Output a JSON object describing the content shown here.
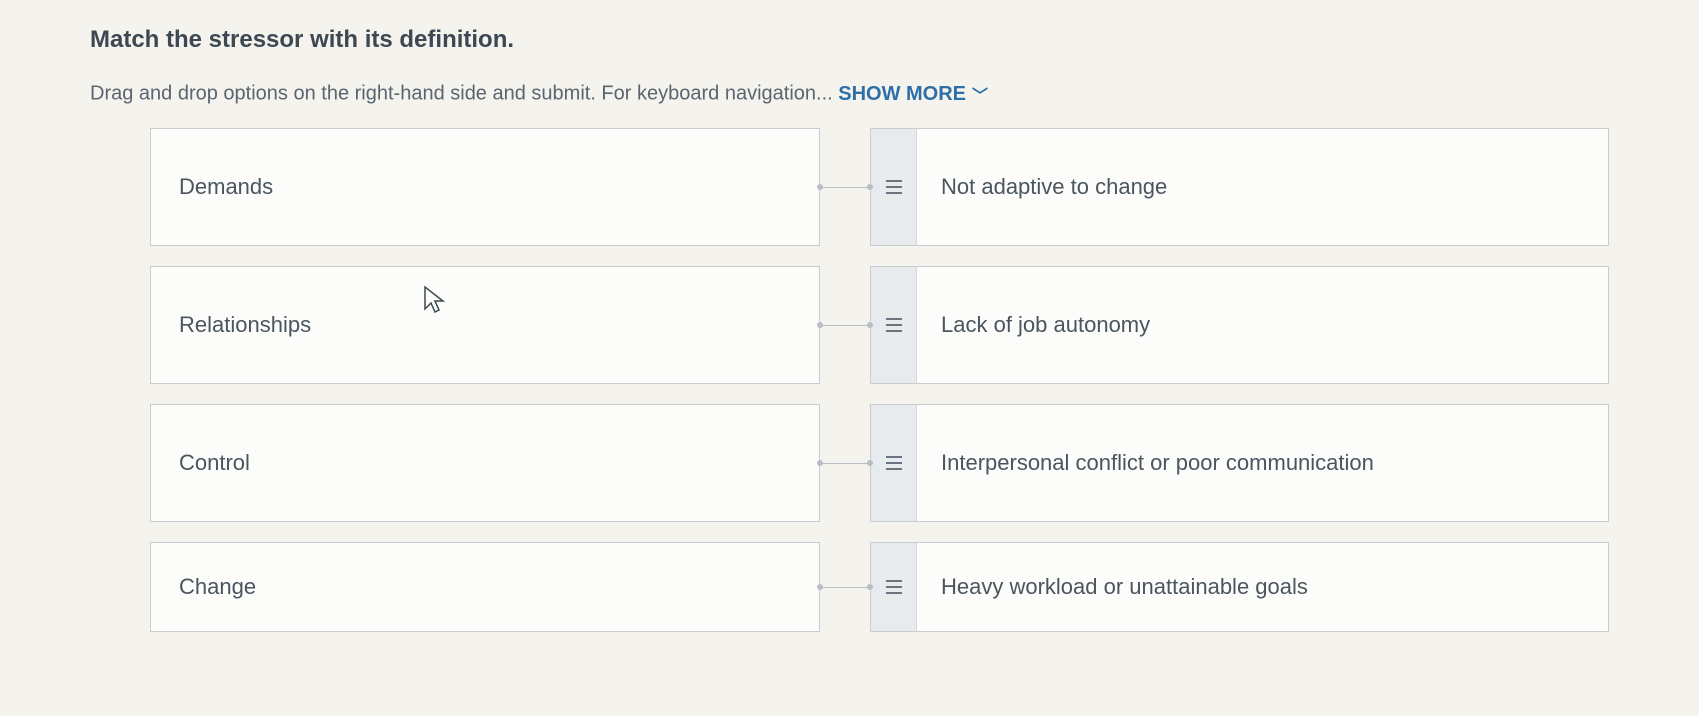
{
  "question": "Match the stressor with its definition.",
  "instructions_prefix": "Drag and drop options on the right-hand side and submit. For keyboard navigation... ",
  "show_more_label": "SHOW MORE",
  "rows": [
    {
      "left": "Demands",
      "right": "Not adaptive to change"
    },
    {
      "left": "Relationships",
      "right": "Lack of job autonomy"
    },
    {
      "left": "Control",
      "right": "Interpersonal conflict or poor communication"
    },
    {
      "left": "Change",
      "right": "Heavy workload or unattainable goals"
    }
  ]
}
